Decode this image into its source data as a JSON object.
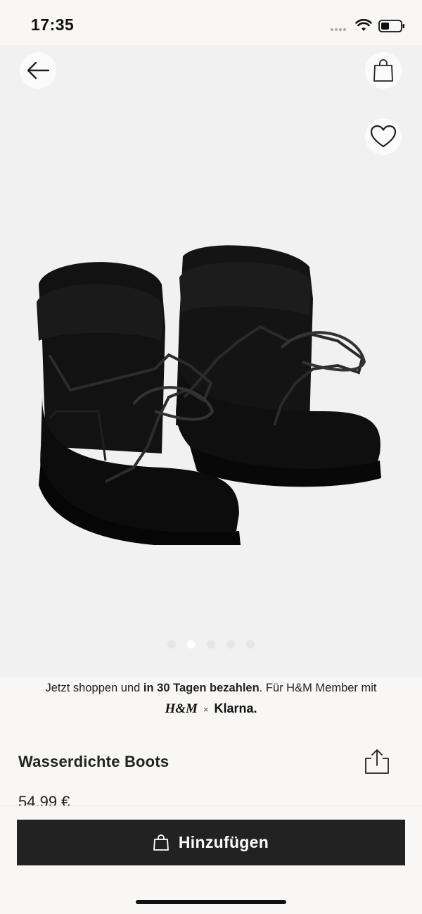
{
  "status_bar": {
    "time": "17:35"
  },
  "hero": {
    "back_icon": "arrow-left-icon",
    "bag_icon": "shopping-bag-icon",
    "favorite_icon": "heart-outline-icon",
    "image_subject": "boots-image",
    "carousel": {
      "total": 5,
      "active_index": 1
    }
  },
  "klarna_banner": {
    "text_before": "Jetzt shoppen und ",
    "text_bold": "in 30 Tagen bezahlen",
    "text_after": ". Für H&M Member mit",
    "hm_logo": "H&M",
    "times": "×",
    "klarna_logo": "Klarna."
  },
  "product": {
    "title": "Wasserdichte Boots",
    "price": "54,99 €",
    "share_icon": "share-icon"
  },
  "bottom_bar": {
    "add_label": "Hinzufügen",
    "add_icon": "shopping-bag-icon"
  },
  "colors": {
    "background": "#f8f7f5",
    "hero_background": "#f1f1f1",
    "button": "#222222"
  }
}
